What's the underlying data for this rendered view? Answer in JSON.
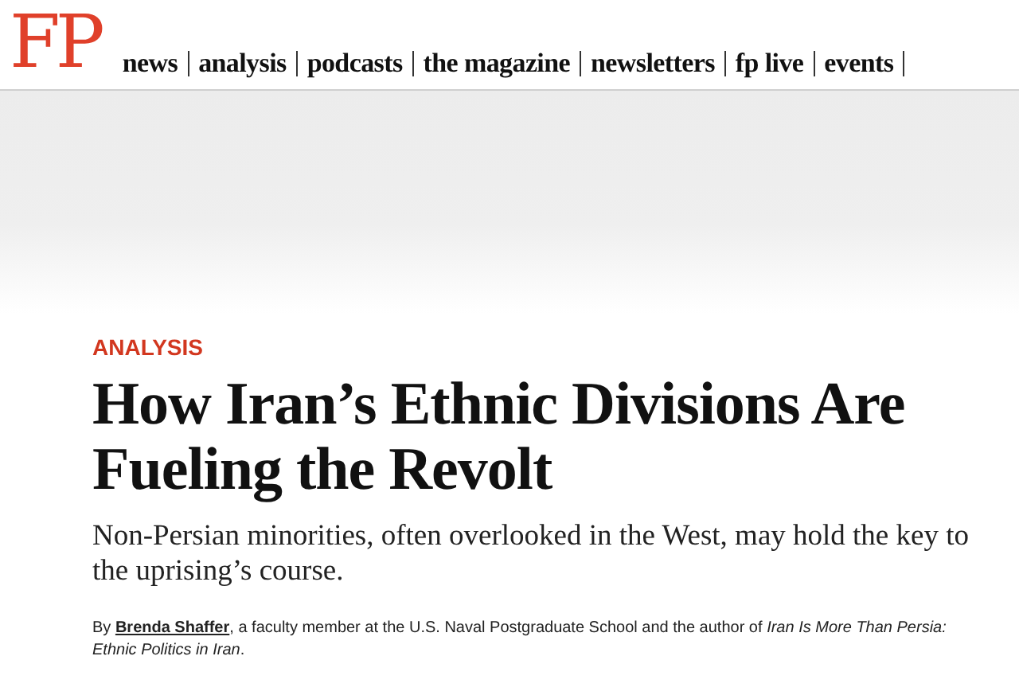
{
  "logo": "FP",
  "nav": [
    "news",
    "analysis",
    "podcasts",
    "the magazine",
    "newsletters",
    "fp live",
    "events"
  ],
  "ad": {
    "kind": "banner"
  },
  "article": {
    "kicker": "ANALYSIS",
    "headline": "How Iran’s Ethnic Divisions Are Fueling the Revolt",
    "dek": "Non-Persian minorities, often overlooked in the West, may hold the key to the uprising’s course.",
    "byline": {
      "prefix": "By",
      "author": "Brenda Shaffer",
      "rest": ", a faculty member at the U.S. Naval Postgraduate School and the author of *Iran Is More Than Persia: Ethnic Politics in Iran*."
    }
  }
}
